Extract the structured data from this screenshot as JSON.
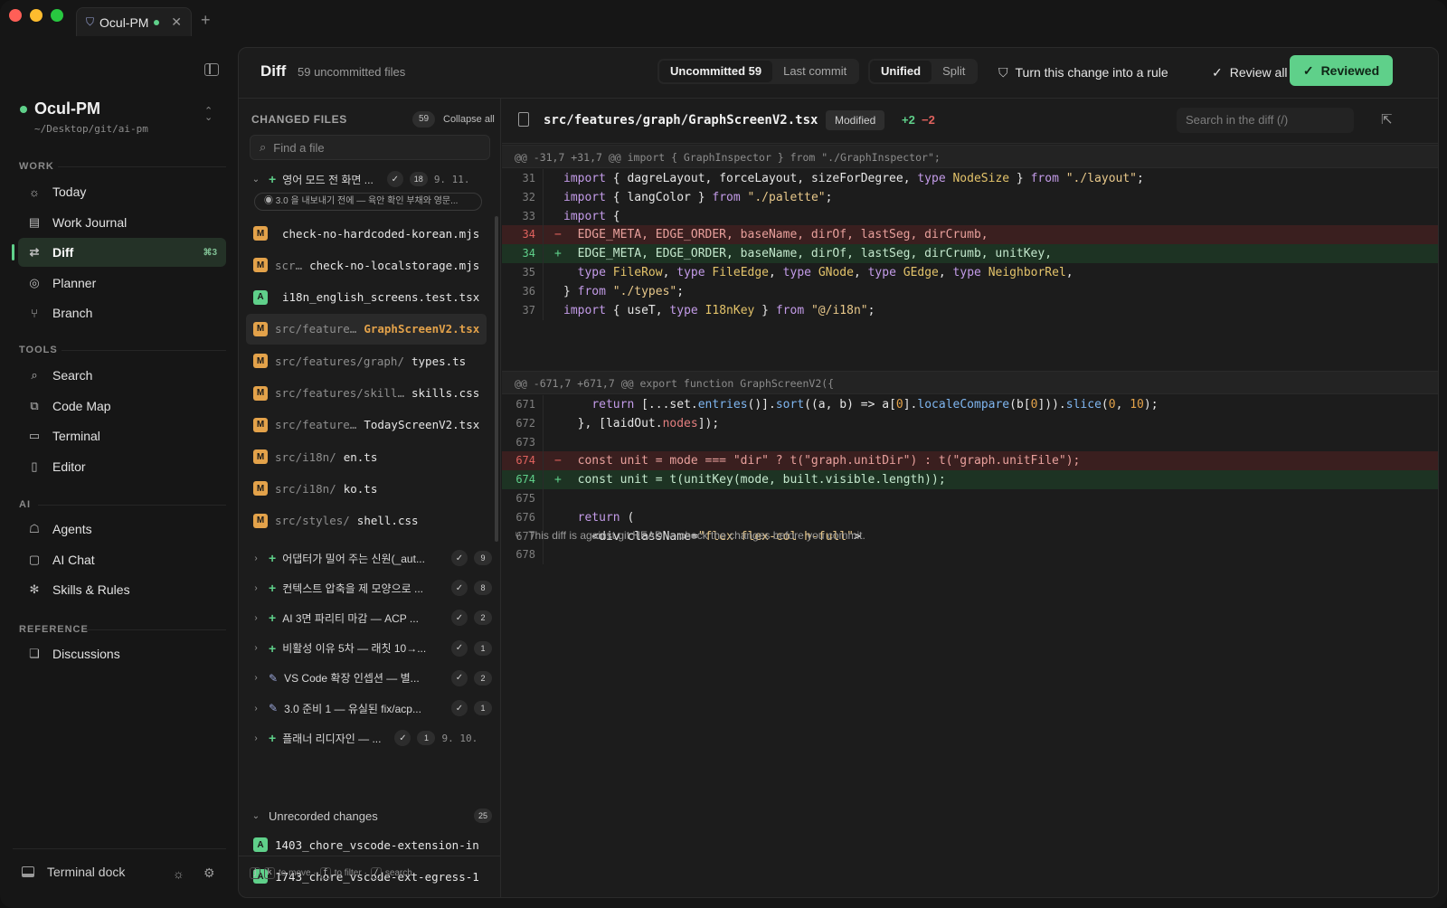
{
  "window": {
    "tab_title": "Ocul-PM",
    "traffic_colors": [
      "#ff5f57",
      "#febc2e",
      "#28c840"
    ]
  },
  "sidebar": {
    "project_name": "Ocul-PM",
    "project_path": "~/Desktop/git/ai-pm",
    "sections": {
      "work": "WORK",
      "tools": "TOOLS",
      "ai": "AI",
      "reference": "REFERENCE"
    },
    "work_items": [
      {
        "label": "Today",
        "icon": "sun-icon"
      },
      {
        "label": "Work Journal",
        "icon": "journal-icon"
      },
      {
        "label": "Diff",
        "icon": "diff-icon",
        "shortcut": "⌘3",
        "active": true
      },
      {
        "label": "Planner",
        "icon": "target-icon"
      },
      {
        "label": "Branch",
        "icon": "branch-icon"
      }
    ],
    "tool_items": [
      {
        "label": "Search",
        "icon": "search-icon"
      },
      {
        "label": "Code Map",
        "icon": "code-map-icon"
      },
      {
        "label": "Terminal",
        "icon": "terminal-icon"
      },
      {
        "label": "Editor",
        "icon": "editor-icon"
      }
    ],
    "ai_items": [
      {
        "label": "Agents",
        "icon": "robot-icon"
      },
      {
        "label": "AI Chat",
        "icon": "chat-icon"
      },
      {
        "label": "Skills & Rules",
        "icon": "puzzle-icon"
      }
    ],
    "reference_items": [
      {
        "label": "Discussions",
        "icon": "discussions-icon"
      }
    ],
    "dock_label": "Terminal dock"
  },
  "header": {
    "title": "Diff",
    "subtitle": "59 uncommitted files",
    "scope_tabs": [
      "Uncommitted 59",
      "Last commit"
    ],
    "view_tabs": [
      "Unified",
      "Split"
    ],
    "rule_button": "Turn this change into a rule",
    "review_all": "Review all",
    "reviewed": "Reviewed"
  },
  "files": {
    "heading": "CHANGED FILES",
    "count": "59",
    "collapse_all": "Collapse all",
    "search_placeholder": "Find a file",
    "open_group": {
      "title": "영어 모드 전 화면 ...",
      "count": "18",
      "date": "9. 11.",
      "note": "3.0 을 내보내기 전에 — 육안 확인 부채와 영문..."
    },
    "rows": [
      {
        "status": "M",
        "dir": "",
        "name": "check-no-hardcoded-korean.mjs"
      },
      {
        "status": "M",
        "dir": "scr…",
        "name": "check-no-localstorage.mjs"
      },
      {
        "status": "A",
        "dir": "",
        "name": "i18n_english_screens.test.tsx"
      },
      {
        "status": "M",
        "dir": "src/feature…",
        "name": "GraphScreenV2.tsx",
        "selected": true
      },
      {
        "status": "M",
        "dir": "src/features/graph/",
        "name": "types.ts"
      },
      {
        "status": "M",
        "dir": "src/features/skill…",
        "name": "skills.css"
      },
      {
        "status": "M",
        "dir": "src/feature…",
        "name": "TodayScreenV2.tsx"
      },
      {
        "status": "M",
        "dir": "src/i18n/",
        "name": "en.ts"
      },
      {
        "status": "M",
        "dir": "src/i18n/",
        "name": "ko.ts"
      },
      {
        "status": "M",
        "dir": "src/styles/",
        "name": "shell.css"
      }
    ],
    "groups": [
      {
        "title": "어댑터가 밀어 주는 신원(_aut...",
        "count": "9",
        "icon": "plus"
      },
      {
        "title": "컨텍스트 압축을 제 모양으로 ...",
        "count": "8",
        "icon": "plus"
      },
      {
        "title": "AI 3면 파리티 마감 — ACP ...",
        "count": "2",
        "icon": "plus"
      },
      {
        "title": "비활성 이유 5차 — 래칫 10→...",
        "count": "1",
        "icon": "plus"
      },
      {
        "title": "VS Code 확장 인셉션 — 별...",
        "count": "2",
        "icon": "wrench"
      },
      {
        "title": "3.0 준비 1 — 유실된 fix/acp...",
        "count": "1",
        "icon": "wrench"
      },
      {
        "title": "플래너 리디자인 — ...",
        "count": "1",
        "icon": "plus",
        "date": "9. 10."
      }
    ],
    "unrecorded": {
      "title": "Unrecorded changes",
      "count": "25"
    },
    "unrecorded_rows": [
      {
        "status": "A",
        "name": "1403_chore_vscode-extension-in"
      },
      {
        "status": "A",
        "name": "1743_chore_vscode-ext-egress-1"
      }
    ],
    "hint": {
      "k1": "j",
      "k2": "k",
      "move": "to move ·",
      "k3": "f",
      "filter": "to filter ·",
      "k4": "/",
      "search": "search"
    }
  },
  "diff": {
    "path": "src/features/graph/GraphScreenV2.tsx",
    "status": "Modified",
    "additions": "+2",
    "deletions": "−2",
    "search_placeholder": "Search in the diff (/)",
    "hunk1": "@@ -31,7 +31,7 @@ import { GraphInspector } from \"./GraphInspector\";",
    "hunk2": "@@ -671,7 +671,7 @@ export function GraphScreenV2({",
    "footer": "This diff is against git HEAD — check the changes before you commit.",
    "lines1": [
      {
        "n": "31",
        "t": "",
        "code": "import { dagreLayout, forceLayout, sizeForDegree, type NodeSize } from \"./layout\";"
      },
      {
        "n": "32",
        "t": "",
        "code": "import { langColor } from \"./palette\";"
      },
      {
        "n": "33",
        "t": "",
        "code": "import {"
      },
      {
        "n": "34",
        "t": "del",
        "code": "  EDGE_META, EDGE_ORDER, baseName, dirOf, lastSeg, dirCrumb,"
      },
      {
        "n": "34",
        "t": "add",
        "code": "  EDGE_META, EDGE_ORDER, baseName, dirOf, lastSeg, dirCrumb, unitKey,"
      },
      {
        "n": "35",
        "t": "",
        "code": "  type FileRow, type FileEdge, type GNode, type GEdge, type NeighborRel,"
      },
      {
        "n": "36",
        "t": "",
        "code": "} from \"./types\";"
      },
      {
        "n": "37",
        "t": "",
        "code": "import { useT, type I18nKey } from \"@/i18n\";"
      }
    ],
    "lines2": [
      {
        "n": "671",
        "t": "",
        "code": "    return [...set.entries()].sort((a, b) => a[0].localeCompare(b[0])).slice(0, 10);"
      },
      {
        "n": "672",
        "t": "",
        "code": "  }, [laidOut.nodes]);"
      },
      {
        "n": "673",
        "t": "",
        "code": ""
      },
      {
        "n": "674",
        "t": "del",
        "code": "  const unit = mode === \"dir\" ? t(\"graph.unitDir\") : t(\"graph.unitFile\");"
      },
      {
        "n": "674",
        "t": "add",
        "code": "  const unit = t(unitKey(mode, built.visible.length));"
      },
      {
        "n": "675",
        "t": "",
        "code": ""
      },
      {
        "n": "676",
        "t": "",
        "code": "  return ("
      },
      {
        "n": "677",
        "t": "",
        "code": "    <div className=\"flex flex-col h-full\">"
      },
      {
        "n": "678",
        "t": "",
        "code": ""
      }
    ]
  }
}
